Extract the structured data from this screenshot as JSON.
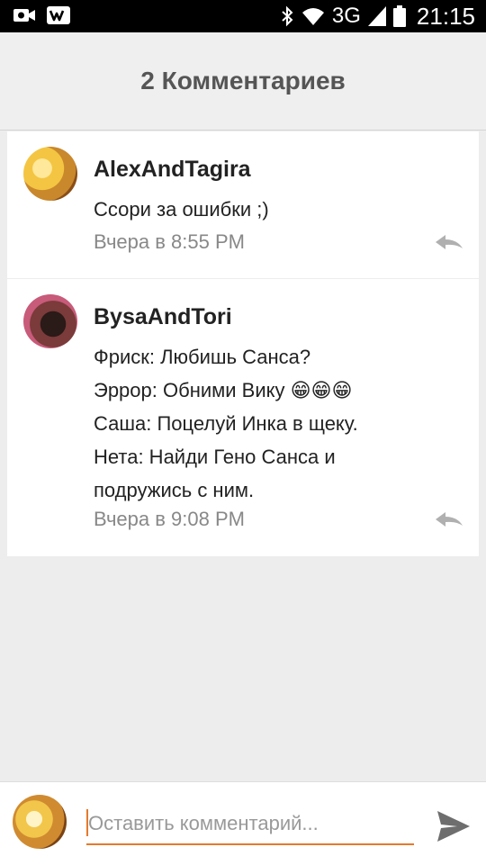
{
  "status_bar": {
    "network": "3G",
    "time": "21:15"
  },
  "header": {
    "title": "2 Комментариев"
  },
  "comments": [
    {
      "author": "AlexAndTagira",
      "lines": [
        "Ссори за ошибки ;)"
      ],
      "time": "Вчера в 8:55 PM"
    },
    {
      "author": "BysaAndTori",
      "lines": [
        "Фриск: Любишь Санса?",
        "Эррор: Обними Вику 😁😁😁",
        "Саша: Поцелуй Инка в щеку.",
        "Нета: Найди Гено Санса и",
        "подружись с ним."
      ],
      "time": "Вчера в 9:08 PM"
    }
  ],
  "input_bar": {
    "placeholder": "Оставить комментарий..."
  },
  "colors": {
    "accent": "#e5792d",
    "header_text": "#555555",
    "timestamp": "#888888",
    "background": "#ededed"
  }
}
